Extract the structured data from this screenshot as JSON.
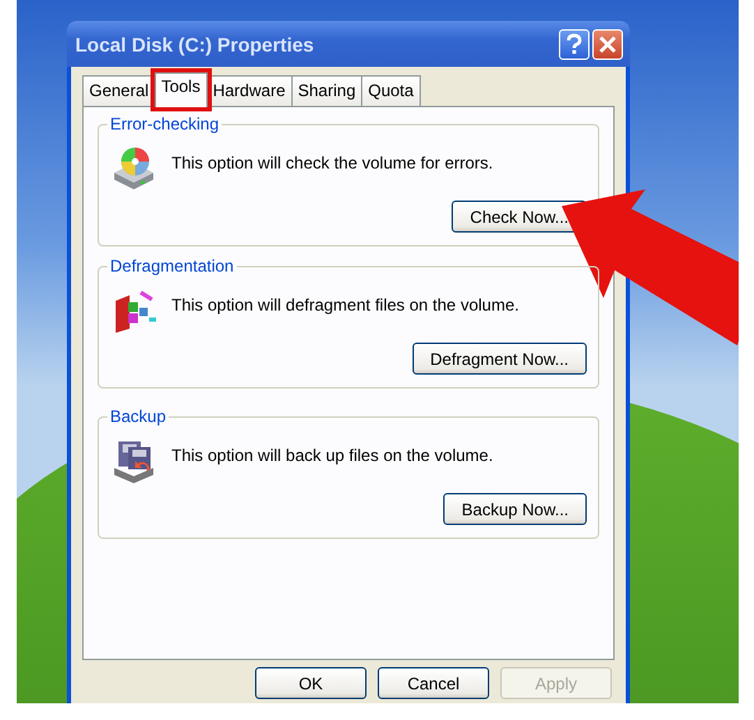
{
  "window": {
    "title": "Local Disk (C:) Properties"
  },
  "tabs": [
    {
      "label": "General",
      "selected": false,
      "highlighted": false
    },
    {
      "label": "Tools",
      "selected": true,
      "highlighted": true
    },
    {
      "label": "Hardware",
      "selected": false,
      "highlighted": false
    },
    {
      "label": "Sharing",
      "selected": false,
      "highlighted": false
    },
    {
      "label": "Quota",
      "selected": false,
      "highlighted": false
    }
  ],
  "groups": [
    {
      "kind": "check",
      "title": "Error-checking",
      "description": "This option will check the volume for errors.",
      "button": "Check Now...",
      "arrow": true
    },
    {
      "kind": "defrag",
      "title": "Defragmentation",
      "description": "This option will defragment files on the volume.",
      "button": "Defragment Now...",
      "arrow": false
    },
    {
      "kind": "backup",
      "title": "Backup",
      "description": "This option will back up files on the volume.",
      "button": "Backup Now...",
      "arrow": false
    }
  ],
  "buttons": [
    {
      "label": "OK",
      "disabled": false
    },
    {
      "label": "Cancel",
      "disabled": false
    },
    {
      "label": "Apply",
      "disabled": true
    }
  ]
}
